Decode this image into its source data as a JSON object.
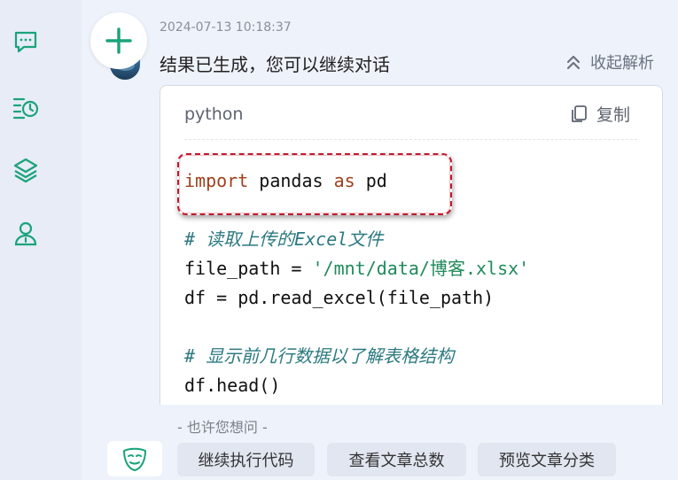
{
  "sidebar": {
    "icons": [
      "chat-bubble-icon",
      "history-clock-icon",
      "layers-icon",
      "user-icon"
    ]
  },
  "message": {
    "timestamp": "2024-07-13 10:18:37",
    "text": "结果已生成，您可以继续对话",
    "collapse_label": "收起解析",
    "collapse_icon": "double-chevron-up-icon"
  },
  "code_block": {
    "language": "python",
    "copy_label": "复制",
    "lines": [
      {
        "kw1": "import",
        "t1": " pandas ",
        "kw2": "as",
        "t2": " pd"
      },
      {
        "text": ""
      },
      {
        "comment": "# 读取上传的Excel文件"
      },
      {
        "pre": "file_path = ",
        "str": "'/mnt/data/博客.xlsx'"
      },
      {
        "text": "df = pd.read_excel(file_path)"
      },
      {
        "text": ""
      },
      {
        "comment": "# 显示前几行数据以了解表格结构"
      },
      {
        "text": "df.head()"
      }
    ]
  },
  "suggestions": {
    "title": "- 也许您想问 -",
    "chips": [
      "继续执行代码",
      "查看文章总数",
      "预览文章分类"
    ]
  },
  "colors": {
    "accent": "#1aa37a",
    "highlight": "#c0192c",
    "keyword": "#a0401c",
    "string": "#1f8a5a",
    "comment": "#2c7a80"
  }
}
